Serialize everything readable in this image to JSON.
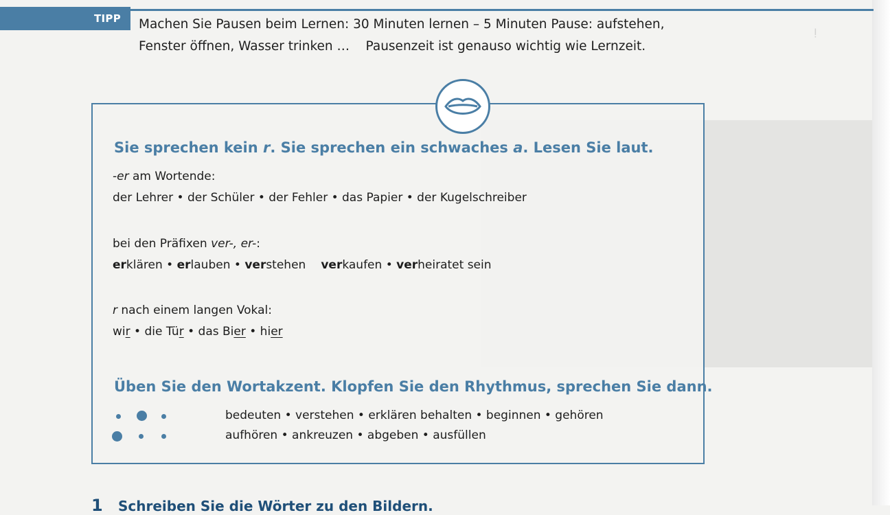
{
  "tipp": {
    "label": "TIPP",
    "line1": "Machen Sie Pausen beim Lernen: 30 Minuten lernen – 5 Minuten Pause: aufstehen,",
    "line2": "Fenster öffnen, Wasser trinken …    Pausenzeit ist genauso wichtig wie Lernzeit."
  },
  "icon": "mouth-icon",
  "section1": {
    "h_a": "Sie sprechen kein ",
    "h_r": "r",
    "h_b": ". Sie sprechen ein schwaches ",
    "h_a2": "a",
    "h_c": ". Lesen Sie laut.",
    "g1_em": "-er",
    "g1_rest": " am Wortende:",
    "g1_words": "der Lehrer • der Schüler • der Fehler • das Papier • der Kugelschreiber",
    "g2_a": "bei den Präfixen ",
    "g2_em": "ver-, er-",
    "g2_b": ":",
    "g3_em": "r",
    "g3_rest": " nach einem langen Vokal:",
    "w": [
      {
        "bold": "er",
        "rest": "klären"
      },
      {
        "bold": "er",
        "rest": "lauben"
      },
      {
        "bold": "ver",
        "rest": "stehen"
      },
      {
        "bold": "ver",
        "rest": "kaufen"
      },
      {
        "bold": "ver",
        "rest": "heiratet sein"
      }
    ],
    "sep": " • ",
    "r1": "wi",
    "r1u": "r",
    "r2": " • die Tü",
    "r2u": "r",
    "r3": " • das Bi",
    "r3u": "er",
    "r4": " • hi",
    "r4u": "er"
  },
  "section2": {
    "heading": "Üben Sie den Wortakzent. Klopfen Sie den Rhythmus, sprechen Sie dann.",
    "row1": "bedeuten • verstehen • erklären   behalten • beginnen • gehören",
    "row2": "aufhören • ankreuzen • abgeben • ausfüllen"
  },
  "exercise": {
    "number": "1",
    "text": "Schreiben Sie die Wörter zu den Bildern."
  },
  "colors": {
    "accent": "#4a7ea5",
    "exercise": "#1f4f78"
  }
}
